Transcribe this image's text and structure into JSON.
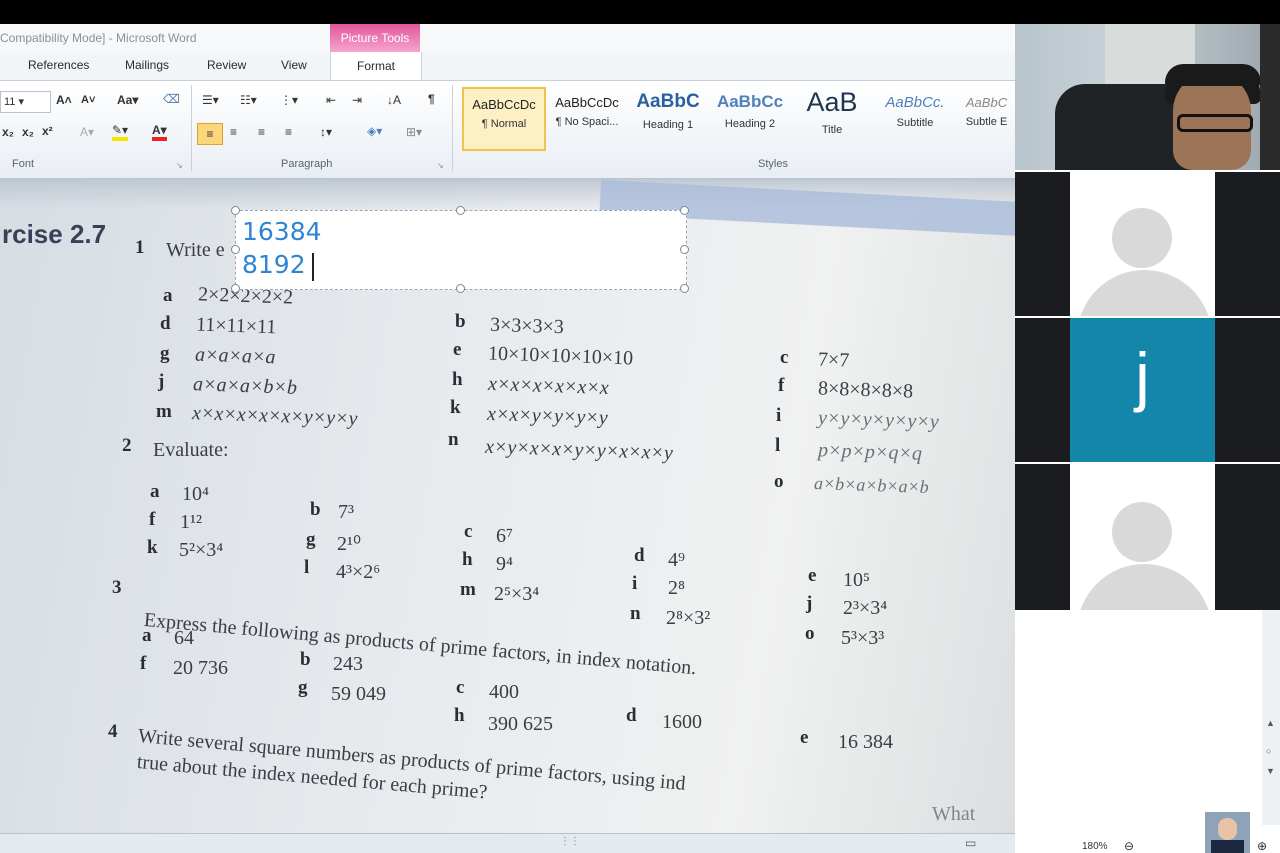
{
  "window": {
    "title": "Compatibility Mode] - Microsoft Word",
    "context_tab_group": "Picture Tools"
  },
  "tabs": [
    "References",
    "Mailings",
    "Review",
    "View",
    "Format"
  ],
  "ribbon": {
    "font_size": "11",
    "group_labels": {
      "font": "Font",
      "paragraph": "Paragraph",
      "styles": "Styles"
    },
    "styles": [
      {
        "sample": "AaBbCcDc",
        "name": "¶ Normal"
      },
      {
        "sample": "AaBbCcDc",
        "name": "¶ No Spaci..."
      },
      {
        "sample": "AaBbC",
        "name": "Heading 1"
      },
      {
        "sample": "AaBbCc",
        "name": "Heading 2"
      },
      {
        "sample": "AaB",
        "name": "Title"
      },
      {
        "sample": "AaBbCc.",
        "name": "Subtitle"
      },
      {
        "sample": "AaBbC",
        "name": "Subtle E"
      }
    ]
  },
  "textbox": {
    "line1": "16384",
    "line2": "8192"
  },
  "textbook": {
    "exercise": "rcise 2.7",
    "q1_number": "1",
    "q1_text": "Write e",
    "q1_items": [
      {
        "label": "a",
        "expr": "2×2×2×2×2"
      },
      {
        "label": "b",
        "expr": "3×3×3×3"
      },
      {
        "label": "c",
        "expr": "7×7"
      },
      {
        "label": "d",
        "expr": "11×11×11"
      },
      {
        "label": "e",
        "expr": "10×10×10×10×10"
      },
      {
        "label": "f",
        "expr": "8×8×8×8×8"
      },
      {
        "label": "g",
        "expr": "a×a×a×a"
      },
      {
        "label": "h",
        "expr": "x×x×x×x×x×x"
      },
      {
        "label": "i",
        "expr": "y×y×y×y×y×y"
      },
      {
        "label": "j",
        "expr": "a×a×a×b×b"
      },
      {
        "label": "k",
        "expr": "x×x×y×y×y×y"
      },
      {
        "label": "l",
        "expr": "p×p×p×q×q"
      },
      {
        "label": "m",
        "expr": "x×x×x×x×x×y×y×y"
      },
      {
        "label": "n",
        "expr": "x×y×x×x×y×y×x×x×y"
      },
      {
        "label": "o",
        "expr": "a×b×a×b×a×b"
      }
    ],
    "q2_number": "2",
    "q2_text": "Evaluate:",
    "q2_items": [
      {
        "label": "a",
        "expr": "10⁴"
      },
      {
        "label": "b",
        "expr": "7³"
      },
      {
        "label": "c",
        "expr": "6⁷"
      },
      {
        "label": "d",
        "expr": "4⁹"
      },
      {
        "label": "e",
        "expr": "10⁵"
      },
      {
        "label": "f",
        "expr": "1¹²"
      },
      {
        "label": "g",
        "expr": "2¹⁰"
      },
      {
        "label": "h",
        "expr": "9⁴"
      },
      {
        "label": "i",
        "expr": "2⁸"
      },
      {
        "label": "j",
        "expr": "2³×3⁴"
      },
      {
        "label": "k",
        "expr": "5²×3⁴"
      },
      {
        "label": "l",
        "expr": "4³×2⁶"
      },
      {
        "label": "m",
        "expr": "2⁵×3⁴"
      },
      {
        "label": "n",
        "expr": "2⁸×3²"
      },
      {
        "label": "o",
        "expr": "5³×3³"
      }
    ],
    "q3_number": "3",
    "q3_text": "Express the following as products of prime factors, in index notation.",
    "q3_items": [
      {
        "label": "a",
        "expr": "64"
      },
      {
        "label": "b",
        "expr": "243"
      },
      {
        "label": "c",
        "expr": "400"
      },
      {
        "label": "d",
        "expr": "1600"
      },
      {
        "label": "e",
        "expr": "16 384"
      },
      {
        "label": "f",
        "expr": "20 736"
      },
      {
        "label": "g",
        "expr": "59 049"
      },
      {
        "label": "h",
        "expr": "390 625"
      }
    ],
    "q4_number": "4",
    "q4_line1": "Write several square numbers as products of prime factors, using ind",
    "q4_tail": "What",
    "q4_line2": "true about the index needed for each prime?"
  },
  "status": {
    "zoom": "180%"
  },
  "zoom_participants": {
    "tile3_initial": "j"
  }
}
